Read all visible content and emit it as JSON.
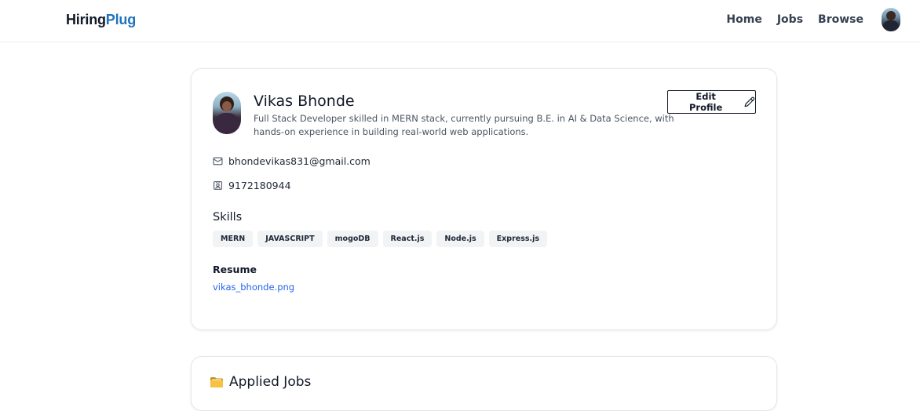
{
  "navbar": {
    "brand_part1": "Hiring",
    "brand_part2": "Plug",
    "links": [
      "Home",
      "Jobs",
      "Browse"
    ]
  },
  "profile": {
    "name": "Vikas Bhonde",
    "bio": "Full Stack Developer skilled in MERN stack, currently pursuing B.E. in AI & Data Science, with hands-on experience in building real-world web applications.",
    "edit_label": "Edit Profile",
    "email": "bhondevikas831@gmail.com",
    "phone": "9172180944",
    "skills_title": "Skills",
    "skills": [
      "MERN",
      "JAVASCRIPT",
      "mogoDB",
      "React.js",
      "Node.js",
      "Express.js"
    ],
    "resume_title": "Resume",
    "resume_file": "vikas_bhonde.png"
  },
  "applied_jobs": {
    "title": "Applied Jobs"
  },
  "colors": {
    "brand_accent": "#1e73be",
    "link": "#2563eb",
    "badge_bg": "#f1f3f5"
  },
  "icons": {
    "email": "mail-icon",
    "phone": "contact-card-icon",
    "edit": "pencil-icon",
    "applied": "folder-icon"
  }
}
